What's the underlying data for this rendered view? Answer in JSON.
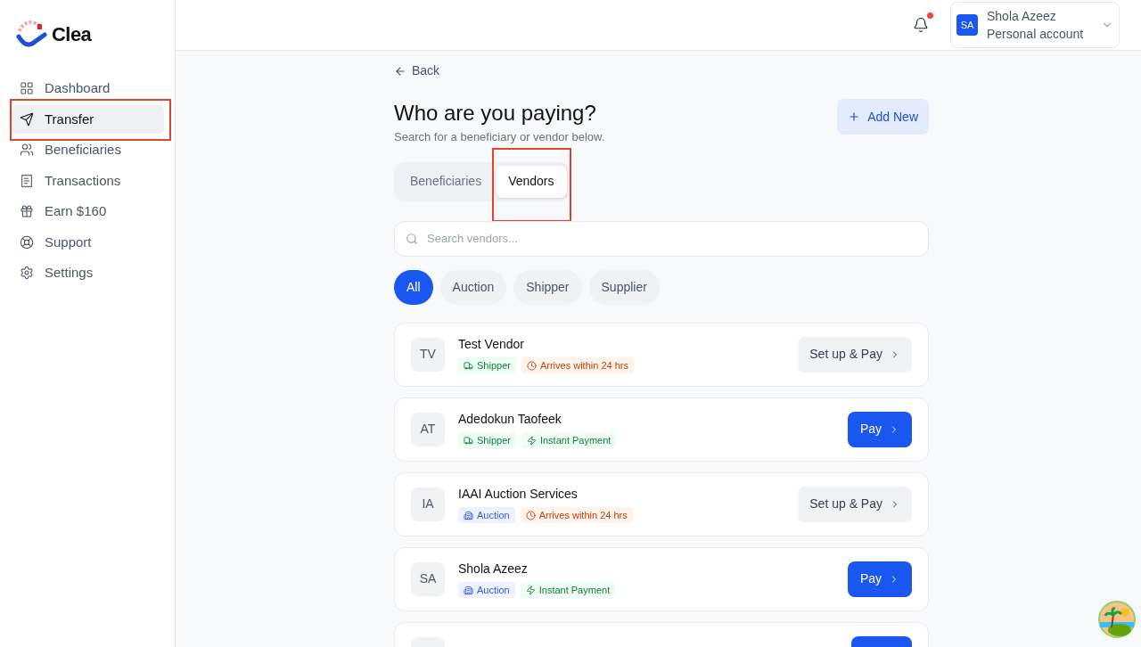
{
  "brand": {
    "name": "Clea"
  },
  "sidebar": {
    "items": [
      {
        "label": "Dashboard",
        "selected": false,
        "outlined": false
      },
      {
        "label": "Transfer",
        "selected": true,
        "outlined": true
      },
      {
        "label": "Beneficiaries",
        "selected": false,
        "outlined": false
      },
      {
        "label": "Transactions",
        "selected": false,
        "outlined": false
      },
      {
        "label": "Earn $160",
        "selected": false,
        "outlined": false
      },
      {
        "label": "Support",
        "selected": false,
        "outlined": false
      },
      {
        "label": "Settings",
        "selected": false,
        "outlined": false
      }
    ]
  },
  "header": {
    "notification_dot": true,
    "account": {
      "initials": "SA",
      "name": "Shola Azeez",
      "type": "Personal account"
    }
  },
  "back": "Back",
  "title": "Who are you paying?",
  "subtitle": "Search for a beneficiary or vendor below.",
  "add_button": "Add New",
  "tabs": [
    {
      "label": "Beneficiaries",
      "selected": false,
      "outlined": false
    },
    {
      "label": "Vendors",
      "selected": true,
      "outlined": true
    }
  ],
  "search": {
    "placeholder": "Search vendors..."
  },
  "filters": [
    {
      "label": "All",
      "selected": true
    },
    {
      "label": "Auction",
      "selected": false
    },
    {
      "label": "Shipper",
      "selected": false
    },
    {
      "label": "Supplier",
      "selected": false
    }
  ],
  "vendors": [
    {
      "initials": "TV",
      "name": "Test Vendor",
      "tags": [
        {
          "kind": "shipper",
          "label": "Shipper"
        },
        {
          "kind": "eta",
          "label": "Arrives within 24 hrs"
        }
      ],
      "action": {
        "kind": "setup",
        "label": "Set up & Pay"
      }
    },
    {
      "initials": "AT",
      "name": "Adedokun Taofeek",
      "tags": [
        {
          "kind": "shipper",
          "label": "Shipper"
        },
        {
          "kind": "instant",
          "label": "Instant Payment"
        }
      ],
      "action": {
        "kind": "pay",
        "label": "Pay"
      }
    },
    {
      "initials": "IA",
      "name": "IAAI Auction Services",
      "tags": [
        {
          "kind": "auction",
          "label": "Auction"
        },
        {
          "kind": "eta",
          "label": "Arrives within 24 hrs"
        }
      ],
      "action": {
        "kind": "setup",
        "label": "Set up & Pay"
      }
    },
    {
      "initials": "SA",
      "name": "Shola Azeez",
      "tags": [
        {
          "kind": "auction",
          "label": "Auction"
        },
        {
          "kind": "instant",
          "label": "Instant Payment"
        }
      ],
      "action": {
        "kind": "pay",
        "label": "Pay"
      }
    }
  ],
  "partial_vendor": {
    "action": {
      "kind": "pay"
    }
  }
}
